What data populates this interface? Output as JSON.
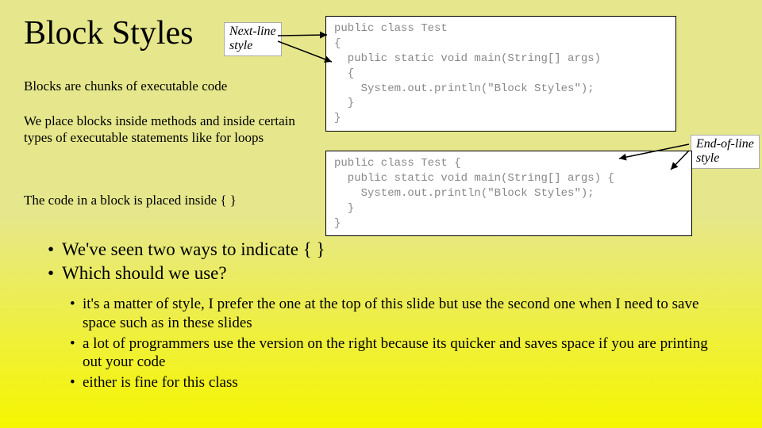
{
  "title": "Block Styles",
  "paragraphs": {
    "p1": "Blocks are chunks of executable code",
    "p2": "We place blocks inside methods and inside certain types of executable statements like for loops",
    "p3": "The code in a block is placed inside { }"
  },
  "callouts": {
    "next_line": "Next-line\nstyle",
    "end_of_line": "End-of-line\nstyle"
  },
  "code": {
    "box1": "public class Test\n{\n  public static void main(String[] args)\n  {\n    System.out.println(\"Block Styles\");\n  }\n}",
    "box2": "public class Test {\n  public static void main(String[] args) {\n    System.out.println(\"Block Styles\");\n  }\n}"
  },
  "bullets_level1": [
    "We've seen two ways to indicate { }",
    "Which should we use?"
  ],
  "bullets_level2": [
    "it's a matter of style, I prefer the one at the top of this slide but use the second one when I need to save space such as in these slides",
    "a lot of programmers use the version on the right because its quicker and saves space if you are printing out your code",
    "either is fine for this class"
  ]
}
